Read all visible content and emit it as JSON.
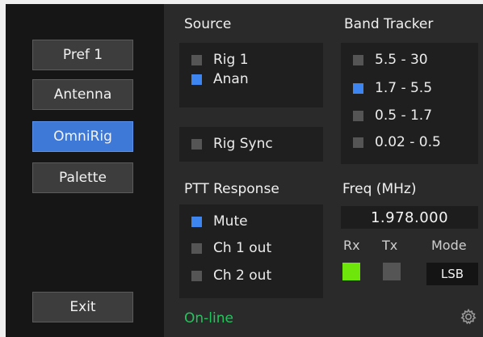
{
  "sidebar": {
    "buttons": [
      {
        "label": "Pref 1"
      },
      {
        "label": "Antenna"
      },
      {
        "label": "OmniRig",
        "active": true
      },
      {
        "label": "Palette"
      }
    ],
    "exit_label": "Exit"
  },
  "source": {
    "title": "Source",
    "items": [
      {
        "label": "Rig 1",
        "checked": false
      },
      {
        "label": "Anan",
        "checked": true
      }
    ],
    "rig_sync": {
      "label": "Rig Sync",
      "checked": false
    }
  },
  "band_tracker": {
    "title": "Band Tracker",
    "items": [
      {
        "label": "5.5 - 30",
        "checked": false
      },
      {
        "label": "1.7 - 5.5",
        "checked": true
      },
      {
        "label": "0.5 - 1.7",
        "checked": false
      },
      {
        "label": "0.02 - 0.5",
        "checked": false
      }
    ]
  },
  "ptt": {
    "title": "PTT Response",
    "items": [
      {
        "label": "Mute",
        "checked": true
      },
      {
        "label": "Ch 1 out",
        "checked": false
      },
      {
        "label": "Ch 2 out",
        "checked": false
      }
    ]
  },
  "freq": {
    "title": "Freq (MHz)",
    "value": "1.978.000",
    "rx_label": "Rx",
    "tx_label": "Tx",
    "mode_label": "Mode",
    "mode_value": "LSB",
    "rx_color": "#6ee60b",
    "tx_color": "#555555"
  },
  "status": {
    "text": "On-line",
    "color": "#22c55e"
  },
  "colors": {
    "accent": "#3f79d8",
    "checked": "#3d85f0",
    "unchecked": "#555555"
  },
  "icons": {
    "settings": "gear-icon"
  }
}
